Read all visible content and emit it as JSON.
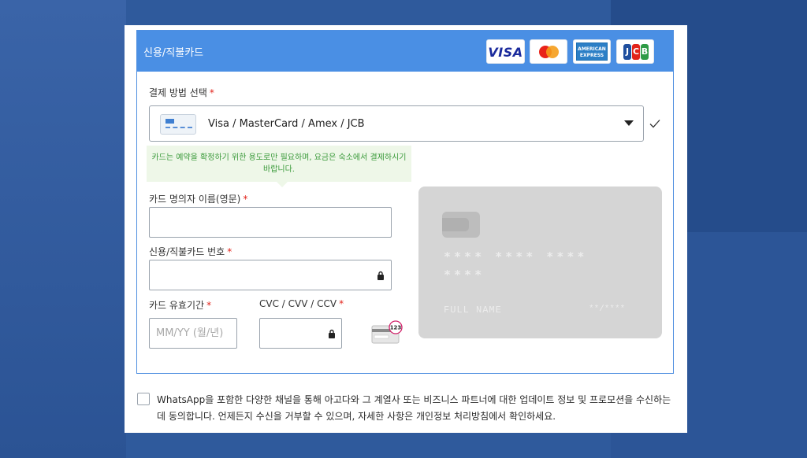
{
  "card_section": {
    "title": "신용/직불카드",
    "logos": [
      {
        "name": "visa-logo",
        "text": "VISA"
      },
      {
        "name": "mastercard-logo"
      },
      {
        "name": "amex-logo",
        "line1": "AMERICAN",
        "line2": "EXPRESS"
      },
      {
        "name": "jcb-logo",
        "letters": [
          "J",
          "C",
          "B"
        ],
        "colors": [
          "#1f4f9e",
          "#e2231a",
          "#2e9b46"
        ]
      }
    ]
  },
  "payment_method": {
    "label": "결제 방법 선택",
    "required_mark": "*",
    "selected": "Visa / MasterCard / Amex / JCB",
    "notice": "카드는 예약을 확정하기 위한 용도로만 필요하며, 요금은 숙소에서 결제하시기 바랍니다."
  },
  "form": {
    "name_label": "카드 명의자 이름(영문)",
    "number_label": "신용/직불카드 번호",
    "expiry_label": "카드 유효기간",
    "expiry_placeholder": "MM/YY (월/년)",
    "cvc_label": "CVC / CVV / CCV",
    "cvc_badge_text": "123",
    "required_mark": "*"
  },
  "card_preview": {
    "number_line1": "**** **** ****",
    "number_line2": "****",
    "name": "FULL NAME",
    "expiry": "**/****"
  },
  "consent": {
    "text": "WhatsApp을 포함한 다양한 채널을 통해 아고다와 그 계열사 또는 비즈니스 파트너에 대한 업데이트 정보 및 프로모션을 수신하는 데 동의합니다. 언제든지 수신을 거부할 수 있으며, 자세한 사항은 개인정보 처리방침에서 확인하세요.",
    "checked": false
  },
  "colors": {
    "header_blue": "#4a8fe4",
    "required_red": "#e2231a",
    "notice_green": "#3a9a3a"
  }
}
